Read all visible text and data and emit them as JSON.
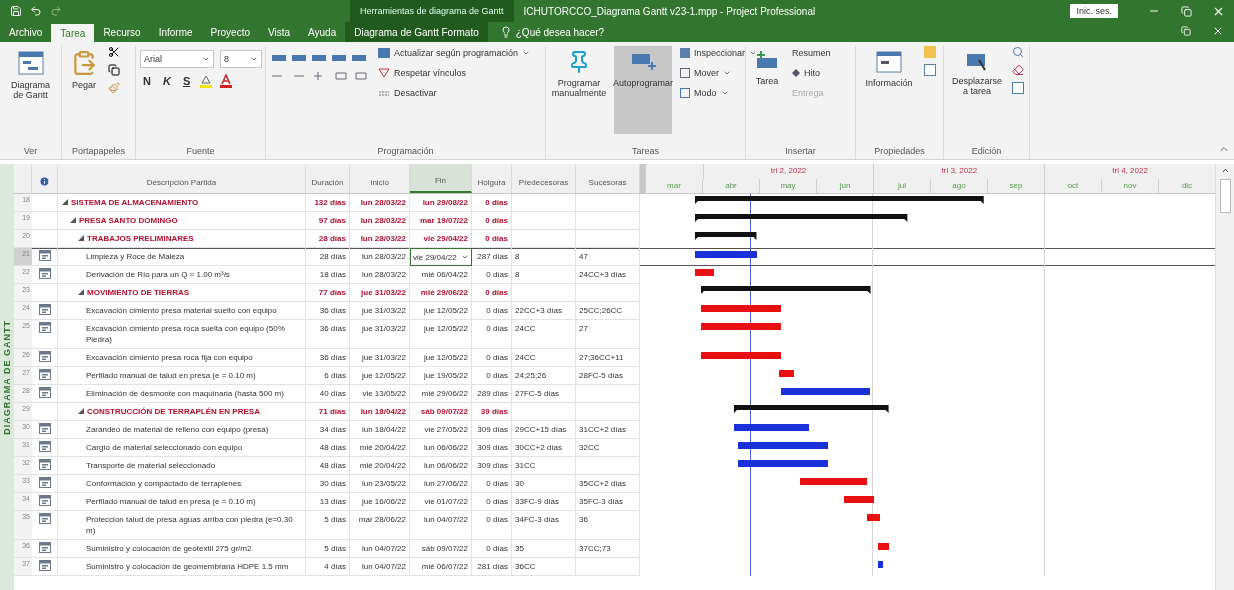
{
  "title_bar": {
    "context_label": "Herramientas de diagrama de Gantt",
    "title": "ICHUTORCCO_Diagrama Gantt v23-1.mpp  -  Project Professional",
    "sign_in": "Inic. ses."
  },
  "tabs": [
    {
      "label": "Archivo",
      "selected": false
    },
    {
      "label": "Tarea",
      "selected": true
    },
    {
      "label": "Recurso",
      "selected": false
    },
    {
      "label": "Informe",
      "selected": false
    },
    {
      "label": "Proyecto",
      "selected": false
    },
    {
      "label": "Vista",
      "selected": false
    },
    {
      "label": "Ayuda",
      "selected": false
    },
    {
      "label": "Diagrama de Gantt Formato",
      "selected": false
    }
  ],
  "tell_me": "¿Qué desea hacer?",
  "ribbon": {
    "view": {
      "button": "Diagrama de Gantt",
      "label": "Ver"
    },
    "clipboard": {
      "paste": "Pegar",
      "label": "Portapapeles"
    },
    "font": {
      "family": "Arial",
      "size": "8",
      "bold": "N",
      "italic": "K",
      "underline": "S",
      "label": "Fuente"
    },
    "schedule": {
      "update": "Actualizar según programación",
      "respect": "Respetar vínculos",
      "deactivate": "Desactivar",
      "label": "Programación"
    },
    "tasks": {
      "buttons": [
        {
          "label": "Programar manualmente",
          "selected": false
        },
        {
          "label": "Autoprogramar",
          "selected": true
        }
      ],
      "inspect": "Inspeccionar",
      "move": "Mover",
      "mode": "Modo",
      "label": "Tareas"
    },
    "insert": {
      "task": "Tarea",
      "summary": "Resumen",
      "milestone": "Hito",
      "deliverable": {
        "label": "Entrega",
        "disabled": true
      },
      "label": "Insertar"
    },
    "properties": {
      "info": "Información",
      "label": "Propiedades"
    },
    "editing": {
      "scroll": "Desplazarse a tarea",
      "label": "Edición"
    }
  },
  "view_bar": "DIAGRAMA DE GANTT",
  "table": {
    "columns": [
      {
        "label": "Descripción Partida",
        "selected": false
      },
      {
        "label": "Duración",
        "selected": false
      },
      {
        "label": "Inicio",
        "selected": false
      },
      {
        "label": "Fin",
        "selected": true
      },
      {
        "label": "Holgura",
        "selected": false
      },
      {
        "label": "Predecesoras",
        "selected": false
      },
      {
        "label": "Sucesoras",
        "selected": false
      }
    ],
    "rows": [
      {
        "id": "18",
        "name": "SISTEMA DE ALMACENAMIENTO",
        "duration": "132 días",
        "start": "lun 28/03/22",
        "finish": "lun 29/08/22",
        "slack": "0 días",
        "selected": false,
        "expanded": true,
        "children": [
          {
            "id": "19",
            "name": "PRESA SANTO DOMINGO",
            "duration": "97 días",
            "start": "lun 28/03/22",
            "finish": "mar 19/07/22",
            "slack": "0 días",
            "selected": false,
            "expanded": true,
            "children": [
              {
                "id": "20",
                "name": "TRABAJOS PRELIMINARES",
                "duration": "28 días",
                "start": "lun 28/03/22",
                "finish": "vie 29/04/22",
                "slack": "0 días",
                "selected": false,
                "expanded": true,
                "children": [
                  {
                    "id": "21",
                    "name": "Limpieza y Roce de Maleza",
                    "duration": "28 días",
                    "start": "lun 28/03/22",
                    "finish": "vie 29/04/22",
                    "slack": "287 días",
                    "predecessors": "8",
                    "successors": "47",
                    "selected": true,
                    "critical": false
                  },
                  {
                    "id": "22",
                    "name": "Derivación de Río para un Q = 1.00 m³/s",
                    "duration": "18 días",
                    "start": "lun 28/03/22",
                    "finish": "mié 06/04/22",
                    "slack": "0 días",
                    "predecessors": "8",
                    "successors": "24CC+3 días",
                    "selected": false,
                    "critical": true
                  }
                ]
              },
              {
                "id": "23",
                "name": "MOVIMIENTO DE TIERRAS",
                "duration": "77 días",
                "start": "jue 31/03/22",
                "finish": "mié 29/06/22",
                "slack": "0 días",
                "selected": false,
                "expanded": true,
                "children": [
                  {
                    "id": "24",
                    "name": "Excavación cimiento presa material suelto con equipo",
                    "duration": "36 días",
                    "start": "jue 31/03/22",
                    "finish": "jue 12/05/22",
                    "slack": "0 días",
                    "predecessors": "22CC+3 días",
                    "successors": "25CC;26CC",
                    "selected": false,
                    "critical": true
                  },
                  {
                    "id": "25",
                    "name": "Excavación cimiento presa roca suelta con equipo (50% Piedra)",
                    "duration": "36 días",
                    "start": "jue 31/03/22",
                    "finish": "jue 12/05/22",
                    "slack": "0 días",
                    "predecessors": "24CC",
                    "successors": "27",
                    "selected": false,
                    "critical": true
                  },
                  {
                    "id": "26",
                    "name": "Excavación cimiento presa roca fija con equipo",
                    "duration": "36 días",
                    "start": "jue 31/03/22",
                    "finish": "jue 12/05/22",
                    "slack": "0 días",
                    "predecessors": "24CC",
                    "successors": "27;36CC+11",
                    "selected": false,
                    "critical": true
                  },
                  {
                    "id": "27",
                    "name": "Perfilado manual de talud en presa (e = 0.10 m)",
                    "duration": "6 días",
                    "start": "jue 12/05/22",
                    "finish": "jue 19/05/22",
                    "slack": "0 días",
                    "predecessors": "24;25;26",
                    "successors": "28FC-5 días",
                    "selected": false,
                    "critical": true
                  },
                  {
                    "id": "28",
                    "name": "Eliminación de desmonte con maquinaria (hasta 500 m)",
                    "duration": "40 días",
                    "start": "vie 13/05/22",
                    "finish": "mié 29/06/22",
                    "slack": "289 días",
                    "predecessors": "27FC-5 días",
                    "selected": false,
                    "critical": false
                  }
                ]
              },
              {
                "id": "29",
                "name": "CONSTRUCCIÓN DE TERRAPLÉN EN PRESA",
                "duration": "71 días",
                "start": "lun 18/04/22",
                "finish": "sáb 09/07/22",
                "slack": "39 días",
                "selected": false,
                "expanded": true,
                "children": [
                  {
                    "id": "30",
                    "name": "Zarandeo de material de relleno con equipo (presa)",
                    "duration": "34 días",
                    "start": "lun 18/04/22",
                    "finish": "vie 27/05/22",
                    "slack": "309 días",
                    "predecessors": "29CC+15 días",
                    "successors": "31CC+2 días",
                    "selected": false,
                    "critical": false
                  },
                  {
                    "id": "31",
                    "name": "Cargío de material seleccionado con equipo",
                    "duration": "48 días",
                    "start": "mié 20/04/22",
                    "finish": "lun 06/06/22",
                    "slack": "309 días",
                    "predecessors": "30CC+2 días",
                    "successors": "32CC",
                    "selected": false,
                    "critical": false
                  },
                  {
                    "id": "32",
                    "name": "Transporte de material seleccionado",
                    "duration": "48 días",
                    "start": "mié 20/04/22",
                    "finish": "lun 06/06/22",
                    "slack": "309 días",
                    "predecessors": "31CC",
                    "selected": false,
                    "critical": false
                  },
                  {
                    "id": "33",
                    "name": "Conformación y compactado de terraplenes",
                    "duration": "30 días",
                    "start": "lun 23/05/22",
                    "finish": "lun 27/06/22",
                    "slack": "0 días",
                    "predecessors": "30",
                    "successors": "35CC+2 días",
                    "selected": false,
                    "critical": true
                  },
                  {
                    "id": "34",
                    "name": "Perfilado manual de talud en presa (e = 0.10 m)",
                    "duration": "13 días",
                    "start": "jue 16/06/22",
                    "finish": "vie 01/07/22",
                    "slack": "0 días",
                    "predecessors": "33FC-9 días",
                    "successors": "35FC-3 días",
                    "selected": false,
                    "critical": true
                  },
                  {
                    "id": "35",
                    "name": "Proteccion talud de presa aguas arriba con piedra (e=0.30 m)",
                    "duration": "5 días",
                    "start": "mar 28/06/22",
                    "finish": "lun 04/07/22",
                    "slack": "0 días",
                    "predecessors": "34FC-3 días",
                    "successors": "36",
                    "selected": false,
                    "critical": true
                  },
                  {
                    "id": "36",
                    "name": "Suministro y colocación de geotextil 275 gr/m2",
                    "duration": "5 días",
                    "start": "lun 04/07/22",
                    "finish": "sáb 09/07/22",
                    "slack": "0 días",
                    "predecessors": "35",
                    "successors": "37CC;73",
                    "selected": false,
                    "critical": true
                  },
                  {
                    "id": "37",
                    "name": "Suministro y colocación de geomembrana HDPE 1.5 mm",
                    "duration": "4 días",
                    "start": "lun 04/07/22",
                    "finish": "mié 06/07/22",
                    "slack": "281 días",
                    "predecessors": "36CC",
                    "selected": false,
                    "critical": false
                  }
                ]
              }
            ]
          }
        ]
      }
    ]
  },
  "timescale": {
    "quarters": [
      "tri 2, 2022",
      "tri 3, 2022",
      "tri 4, 2022"
    ],
    "months": [
      "mar",
      "abr",
      "may",
      "jun",
      "jul",
      "ago",
      "sep",
      "oct",
      "nov",
      "dic"
    ]
  }
}
